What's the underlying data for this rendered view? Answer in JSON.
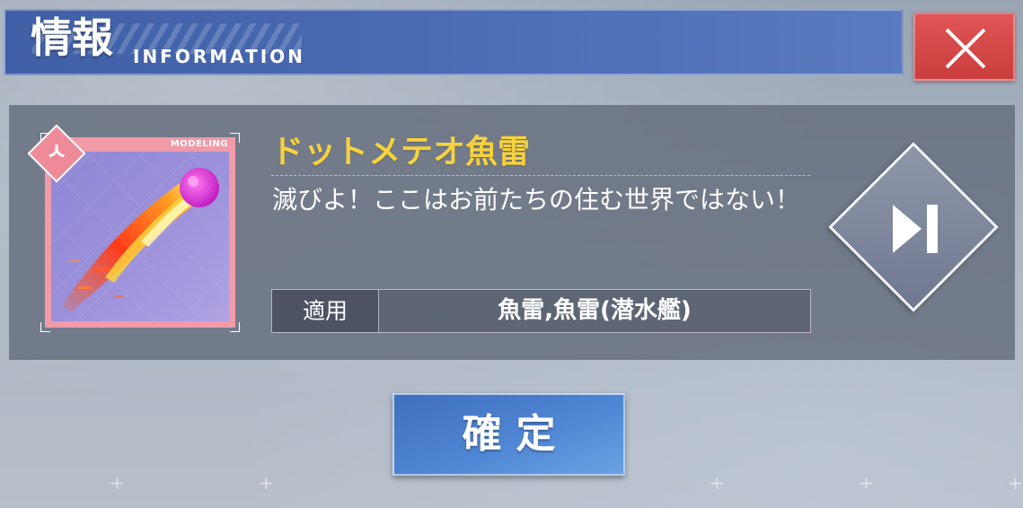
{
  "header": {
    "title_jp": "情報",
    "title_en": "INFORMATION",
    "close_icon": "close-icon"
  },
  "item": {
    "badge_text": "ㅅ",
    "image_tag": "MODELING",
    "name": "ドットメテオ魚雷",
    "description": "滅びよ！ここはお前たちの住む世界ではない！",
    "apply_label": "適用",
    "apply_value": "魚雷,魚雷(潜水艦)"
  },
  "next_button": {
    "icon": "skip-next-icon"
  },
  "confirm_label": "確定",
  "colors": {
    "header_blue": "#4a6ab2",
    "close_red": "#d64848",
    "item_name_yellow": "#f7d23d",
    "thumb_pink": "#f19aa8"
  }
}
